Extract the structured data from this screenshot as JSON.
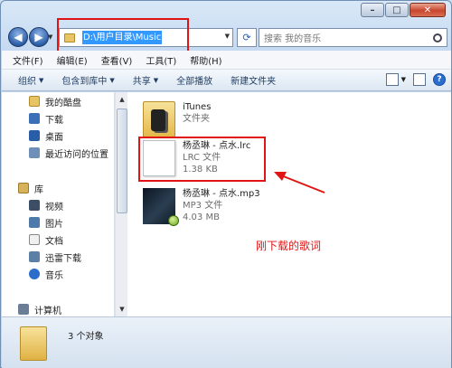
{
  "address": {
    "path": "D:\\用户目录\\Music"
  },
  "search": {
    "placeholder": "搜索 我的音乐"
  },
  "menu": [
    "文件(F)",
    "编辑(E)",
    "查看(V)",
    "工具(T)",
    "帮助(H)"
  ],
  "toolbar": {
    "organize": "组织",
    "include": "包含到库中",
    "share": "共享",
    "play_all": "全部播放",
    "new_folder": "新建文件夹"
  },
  "nav": {
    "items": [
      {
        "label": "我的酷盘",
        "icon": "folder-icon"
      },
      {
        "label": "下载",
        "icon": "download-folder-icon"
      },
      {
        "label": "桌面",
        "icon": "desktop-icon"
      },
      {
        "label": "最近访问的位置",
        "icon": "recent-places-icon"
      },
      {
        "label": "库",
        "icon": "library-icon"
      },
      {
        "label": "视频",
        "icon": "videos-icon"
      },
      {
        "label": "图片",
        "icon": "pictures-icon"
      },
      {
        "label": "文档",
        "icon": "documents-icon"
      },
      {
        "label": "迅雷下载",
        "icon": "thunder-download-icon"
      },
      {
        "label": "音乐",
        "icon": "music-icon"
      },
      {
        "label": "计算机",
        "icon": "computer-icon"
      }
    ]
  },
  "files": [
    {
      "name": "iTunes",
      "type": "文件夹",
      "size": ""
    },
    {
      "name": "杨丞琳 - 点水.lrc",
      "type": "LRC 文件",
      "size": "1.38 KB"
    },
    {
      "name": "杨丞琳 - 点水.mp3",
      "type": "MP3 文件",
      "size": "4.03 MB"
    }
  ],
  "annotation": "刚下载的歌词",
  "status": {
    "count": "3 个对象"
  },
  "colors": {
    "highlight_red": "#e01414",
    "selection_blue": "#3399ff"
  }
}
